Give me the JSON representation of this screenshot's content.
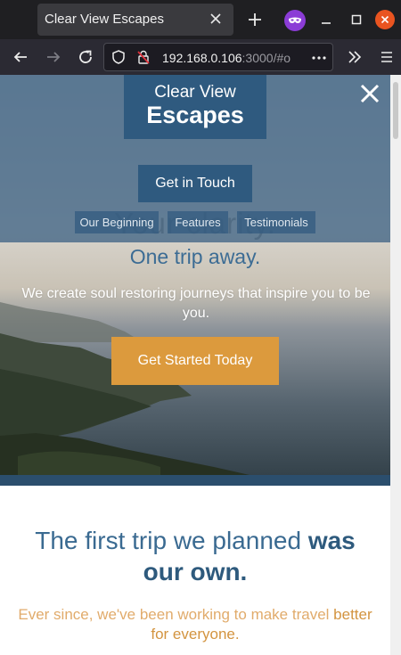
{
  "browser": {
    "tab_title": "Clear View Escapes",
    "url_host": "192.168.0.106",
    "url_rest": ":3000/#o"
  },
  "logo": {
    "line1": "Clear View",
    "line2": "Escapes"
  },
  "menu": {
    "contact_label": "Get in Touch",
    "links": [
      "Our Beginning",
      "Features",
      "Testimonials"
    ]
  },
  "hero": {
    "headline": "Your clarity.",
    "tagline": "One trip away.",
    "description": "We create soul restoring journeys that inspire you to be you.",
    "cta_label": "Get Started Today"
  },
  "intro": {
    "heading_light": "The first trip we planned ",
    "heading_bold": "was our own.",
    "sub_light": "Ever since, we've been working to make travel ",
    "sub_strong": "better for everyone."
  },
  "colors": {
    "brand_blue": "#2f5a7f",
    "accent_orange": "#dc9a3d",
    "browser_chrome": "#2b2a33"
  },
  "icons": {
    "tab_close": "close-icon",
    "new_tab": "plus-icon",
    "private_mode": "private-mask-icon",
    "back": "arrow-left-icon",
    "forward": "arrow-right-icon",
    "reload": "reload-icon",
    "shield": "shield-icon",
    "insecure": "insecure-lock-icon",
    "page_actions": "ellipsis-icon",
    "overflow": "chevrons-right-icon",
    "app_menu": "hamburger-icon",
    "menu_close": "close-icon"
  }
}
